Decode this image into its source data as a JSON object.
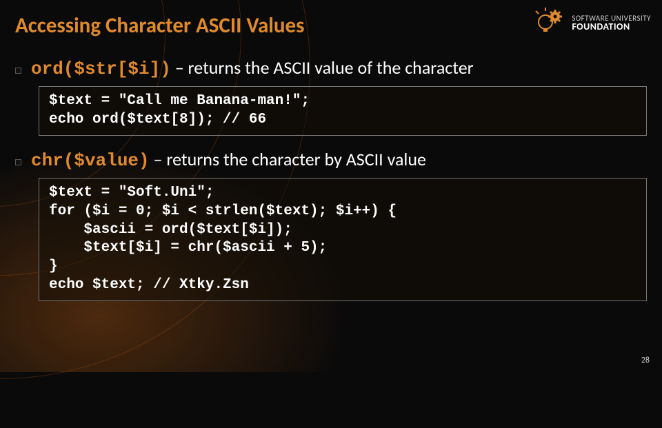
{
  "title": "Accessing Character ASCII Values",
  "logo": {
    "line1": "SOFTWARE UNIVERSITY",
    "line2": "FOUNDATION"
  },
  "bullets": [
    {
      "fn": "ord($str[$i])",
      "desc": " – returns the ASCII value of the character"
    },
    {
      "fn": "chr($value)",
      "desc": " – returns the character by ASCII value"
    }
  ],
  "code1": "$text = \"Call me Banana-man!\";\necho ord($text[8]); // 66",
  "code2": "$text = \"Soft.Uni\";\nfor ($i = 0; $i < strlen($text); $i++) {\n    $ascii = ord($text[$i]);\n    $text[$i] = chr($ascii + 5);\n}\necho $text; // Xtky.Zsn",
  "slide_number": "28"
}
